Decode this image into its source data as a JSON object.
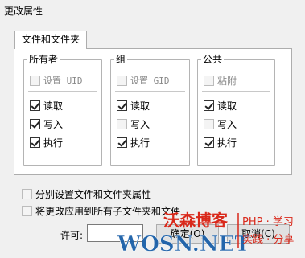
{
  "dialog": {
    "title": "更改属性"
  },
  "tab": {
    "label": "文件和文件夹"
  },
  "groups": {
    "owner": {
      "title": "所有者",
      "special": {
        "label": "设置 UID",
        "checked": false
      },
      "read": {
        "label": "读取",
        "checked": true
      },
      "write": {
        "label": "写入",
        "checked": true
      },
      "execute": {
        "label": "执行",
        "checked": true
      }
    },
    "group": {
      "title": "组",
      "special": {
        "label": "设置 GID",
        "checked": false
      },
      "read": {
        "label": "读取",
        "checked": true
      },
      "write": {
        "label": "写入",
        "checked": false
      },
      "execute": {
        "label": "执行",
        "checked": true
      }
    },
    "public": {
      "title": "公共",
      "special": {
        "label": "粘附",
        "checked": false
      },
      "read": {
        "label": "读取",
        "checked": true
      },
      "write": {
        "label": "写入",
        "checked": false
      },
      "execute": {
        "label": "执行",
        "checked": true
      }
    }
  },
  "options": {
    "separate_attrs": {
      "label": "分别设置文件和文件夹属性",
      "checked": false
    },
    "apply_recursive": {
      "label": "将更改应用到所有子文件夹和文件",
      "checked": false
    }
  },
  "permissions": {
    "label": "许可:",
    "value": ""
  },
  "buttons": {
    "ok": "确定(O)",
    "cancel": "取消(C)"
  },
  "watermark": {
    "site_name": "沃森博客",
    "domain": "WOSN.NET",
    "slogan_top": "PHP · 学习",
    "slogan_bottom": "实践 · 分享"
  }
}
